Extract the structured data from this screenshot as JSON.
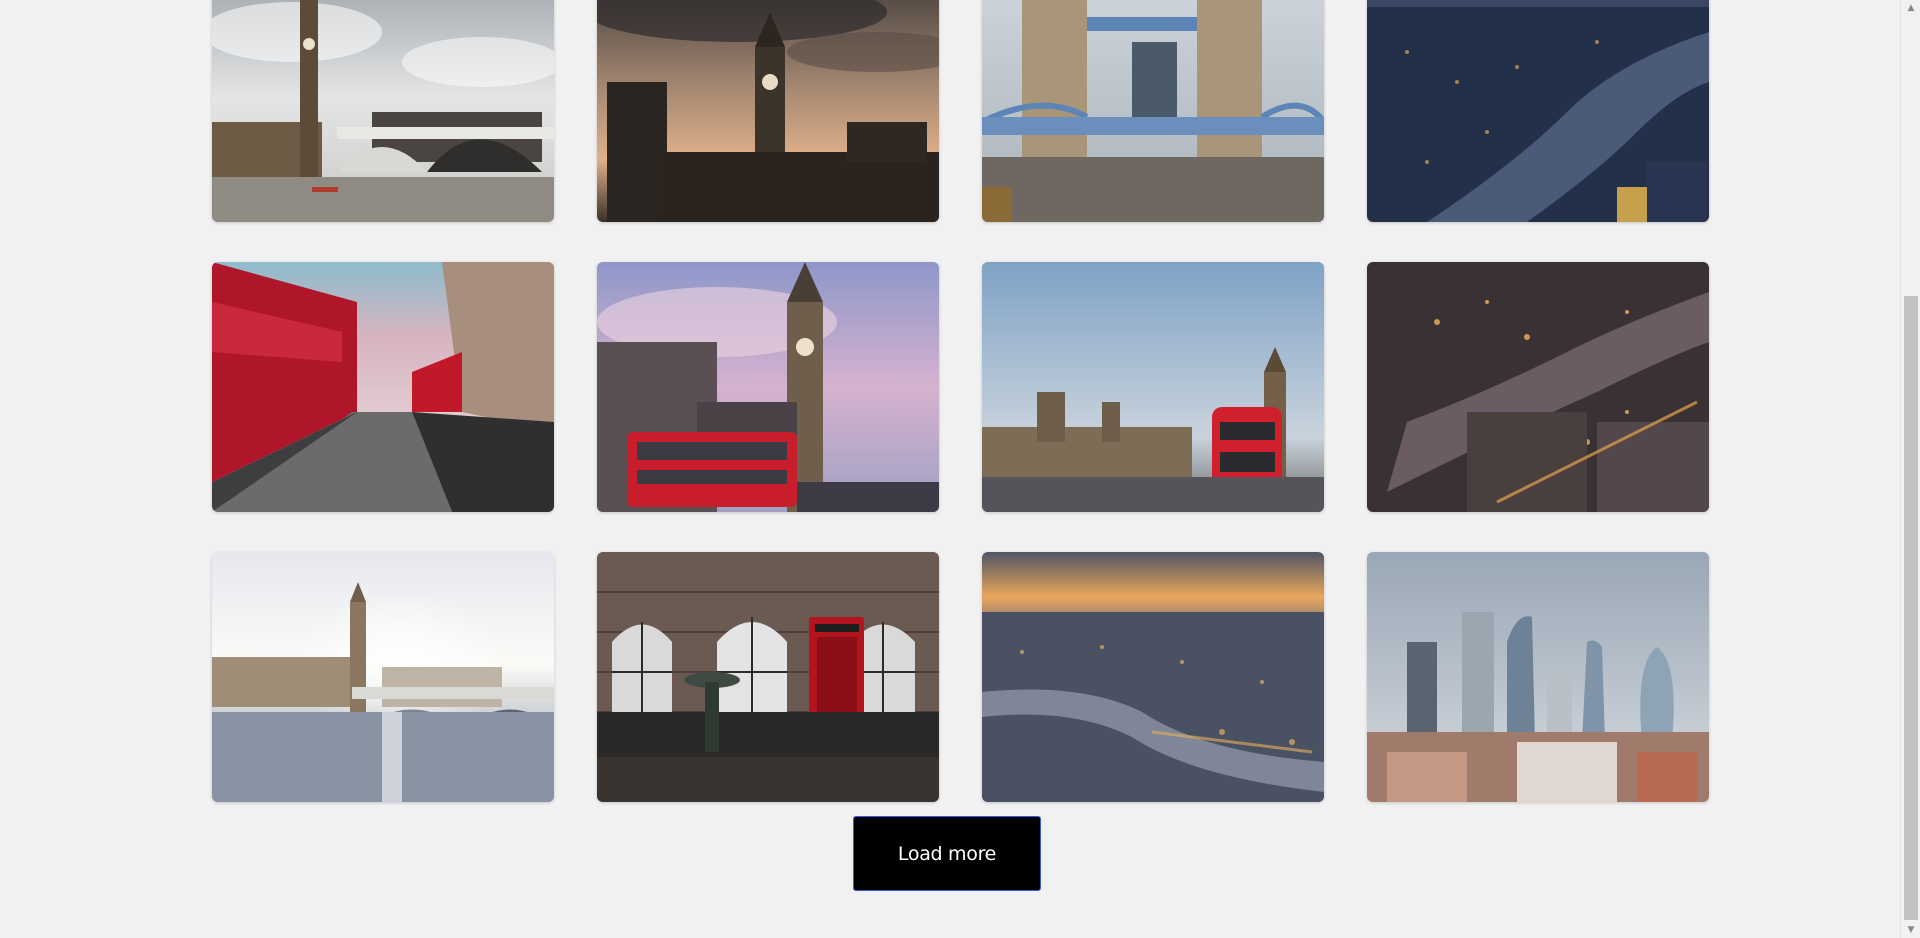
{
  "gallery": {
    "tiles": [
      {
        "subject": "westminster-bridge-big-ben-cloudy"
      },
      {
        "subject": "big-ben-sunset-silhouette"
      },
      {
        "subject": "tower-bridge-daytime"
      },
      {
        "subject": "thames-aerial-dusk"
      },
      {
        "subject": "red-bus-motion-street"
      },
      {
        "subject": "big-ben-red-bus-purple-sky"
      },
      {
        "subject": "parliament-red-bus-blue-sky"
      },
      {
        "subject": "thames-aerial-night-lights"
      },
      {
        "subject": "westminster-bridge-sunrise"
      },
      {
        "subject": "red-telephone-box"
      },
      {
        "subject": "london-aerial-golden-hour"
      },
      {
        "subject": "city-skyscrapers-skyline"
      }
    ]
  },
  "load_more": {
    "label": "Load more"
  },
  "scrollbar": {
    "up_glyph": "▲",
    "down_glyph": "▼"
  }
}
